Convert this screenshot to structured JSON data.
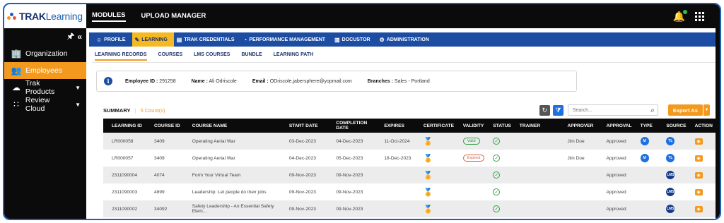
{
  "colors": {
    "brand_blue": "#1c4da3",
    "accent_orange": "#f39a1e",
    "tab_yellow": "#f5b921",
    "valid_green": "#2ea043",
    "expired_red": "#e05b4b"
  },
  "logo": {
    "prefix": "TRAK",
    "suffix": "Learning"
  },
  "sidebar": {
    "items": [
      {
        "label": "Organization",
        "icon": "building-icon",
        "active": false,
        "caret": false
      },
      {
        "label": "Employees",
        "icon": "users-icon",
        "active": true,
        "caret": false
      },
      {
        "label": "Trak Products",
        "icon": "cloud-icon",
        "active": false,
        "caret": true
      },
      {
        "label": "Review Cloud",
        "icon": "dots-cloud-icon",
        "active": false,
        "caret": true
      }
    ]
  },
  "topbar": {
    "modules": "MODULES",
    "upload_manager": "UPLOAD MANAGER"
  },
  "module_tabs": [
    {
      "label": "PROFILE",
      "icon": "user-icon"
    },
    {
      "label": "LEARNING",
      "icon": "learning-icon"
    },
    {
      "label": "TRAK CREDENTIALS",
      "icon": "credentials-icon"
    },
    {
      "label": "PERFORMANCE MANAGEMENT",
      "icon": "gauge-icon"
    },
    {
      "label": "DOCUSTOR",
      "icon": "document-icon"
    },
    {
      "label": "ADMINISTRATION",
      "icon": "admin-gear-icon"
    }
  ],
  "sub_tabs": [
    "LEARNING RECORDS",
    "COURSES",
    "LMS COURSES",
    "BUNDLE",
    "LEARNING PATH"
  ],
  "employee": {
    "id_label": "Employee ID :",
    "id": "291258",
    "name_label": "Name :",
    "name": "Ali Odriscole",
    "email_label": "Email :",
    "email": "ODriscole.jabersphere@yopmail.com",
    "branches_label": "Branches :",
    "branches": "Sales - Portland"
  },
  "summary": {
    "label": "SUMMARY",
    "count": "5 Count(s)"
  },
  "search": {
    "placeholder": "Search..."
  },
  "export": {
    "label": "Export As"
  },
  "table": {
    "headers": [
      "LEARNING ID",
      "COURSE ID",
      "COURSE NAME",
      "START DATE",
      "COMPLETION DATE",
      "EXPIRES",
      "CERTIFICATE",
      "VALIDITY",
      "STATUS",
      "TRAINER",
      "APPROVER",
      "APPROVAL",
      "TYPE",
      "SOURCE",
      "ACTION"
    ],
    "rows": [
      {
        "learning_id": "LR000058",
        "course_id": "3409",
        "course_name": "Operating Aerial War",
        "start": "03-Dec-2023",
        "completion": "04-Dec-2023",
        "expires": "11-Oct-2024",
        "validity": "Valid",
        "approver": "Jim Doe",
        "approval": "Approved",
        "type": "M",
        "source": "TL"
      },
      {
        "learning_id": "LR000057",
        "course_id": "3409",
        "course_name": "Operating Aerial War",
        "start": "04-Dec-2023",
        "completion": "05-Dec-2023",
        "expires": "18-Dec-2023",
        "validity": "Expired",
        "approver": "Jim Doe",
        "approval": "Approved",
        "type": "M",
        "source": "TL"
      },
      {
        "learning_id": "2311090004",
        "course_id": "4074",
        "course_name": "Form Your Virtual Team",
        "start": "09-Nov-2023",
        "completion": "09-Nov-2023",
        "expires": "",
        "validity": "",
        "approver": "",
        "approval": "Approved",
        "type": "",
        "source": "LMS"
      },
      {
        "learning_id": "2311090003",
        "course_id": "4899",
        "course_name": "Leadership: Let people do their jobs",
        "start": "09-Nov-2023",
        "completion": "09-Nov-2023",
        "expires": "",
        "validity": "",
        "approver": "",
        "approval": "Approved",
        "type": "",
        "source": "LMS"
      },
      {
        "learning_id": "2311090002",
        "course_id": "34092",
        "course_name": "Safety Leadership - An Essential Safety Elem...",
        "start": "09-Nov-2023",
        "completion": "09-Nov-2023",
        "expires": "",
        "validity": "",
        "approver": "",
        "approval": "Approved",
        "type": "",
        "source": "LMS"
      }
    ]
  }
}
